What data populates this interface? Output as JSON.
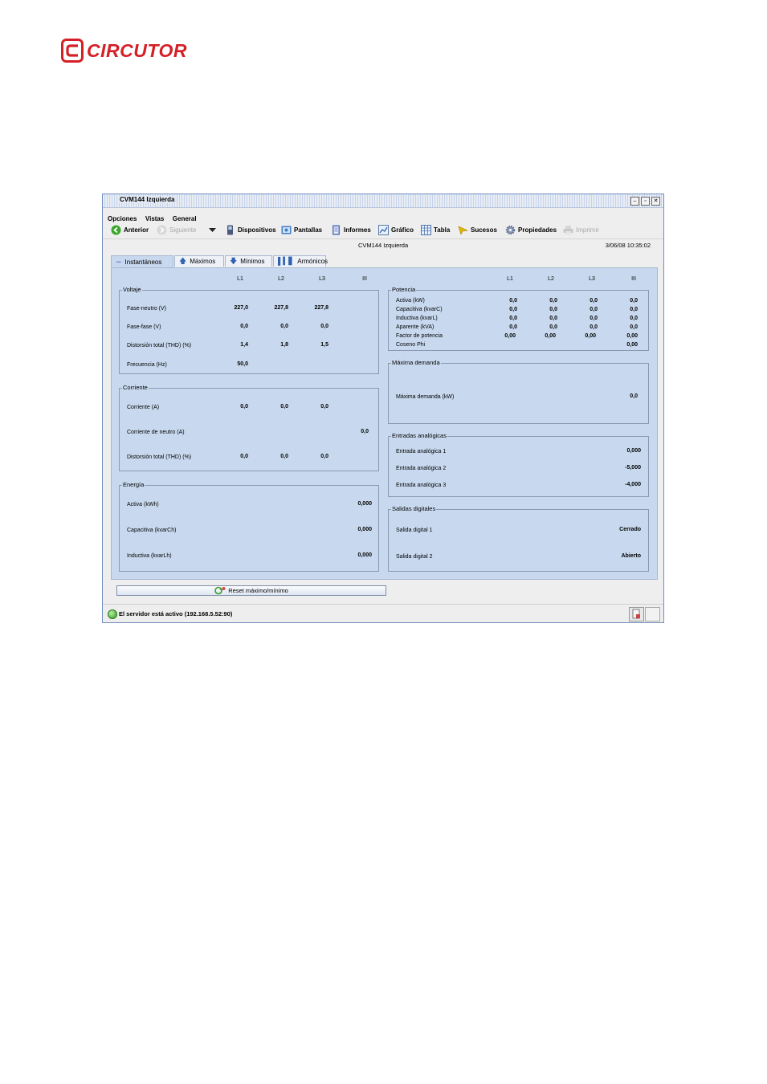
{
  "brand": {
    "logo_text": "CIRCUTOR",
    "color": "#d42027"
  },
  "window": {
    "title": "CVM144 Izquierda",
    "menu": [
      "Opciones",
      "Vistas",
      "General"
    ],
    "toolbar": {
      "anterior": "Anterior",
      "siguiente": "Siguiente",
      "dispositivos": "Dispositivos",
      "pantallas": "Pantallas",
      "informes": "Informes",
      "grafico": "Gráfico",
      "tabla": "Tabla",
      "sucesos": "Sucesos",
      "propiedades": "Propiedades",
      "imprimir": "Imprimir"
    },
    "device_name": "CVM144 Izquierda",
    "datetime": "3/06/08 10:35:02",
    "tabs": [
      "Instantáneos",
      "Máximos",
      "Mínimos",
      "Armónicos"
    ],
    "active_tab": "Instantáneos",
    "columns_left": [
      "L1",
      "L2",
      "L3",
      "III"
    ],
    "columns_right": [
      "L1",
      "L2",
      "L3",
      "III"
    ],
    "voltaje": {
      "title": "Voltaje",
      "rows": [
        {
          "label": "Fase-neutro (V)",
          "l1": "227,0",
          "l2": "227,8",
          "l3": "227,8"
        },
        {
          "label": "Fase-fase (V)",
          "l1": "0,0",
          "l2": "0,0",
          "l3": "0,0"
        },
        {
          "label": "Distorsión total (THD) (%)",
          "l1": "1,4",
          "l2": "1,8",
          "l3": "1,5"
        },
        {
          "label": "Frecuencia (Hz)",
          "l1": "50,0"
        }
      ]
    },
    "corriente": {
      "title": "Corriente",
      "rows": [
        {
          "label": "Corriente (A)",
          "l1": "0,0",
          "l2": "0,0",
          "l3": "0,0"
        },
        {
          "label": "Corriente de neutro (A)",
          "iii": "0,0"
        },
        {
          "label": "Distorsión total (THD) (%)",
          "l1": "0,0",
          "l2": "0,0",
          "l3": "0,0"
        }
      ]
    },
    "energia": {
      "title": "Energía",
      "rows": [
        {
          "label": "Activa (kWh)",
          "iii": "0,000"
        },
        {
          "label": "Capacitiva (kvarCh)",
          "iii": "0,000"
        },
        {
          "label": "Inductiva (kvarLh)",
          "iii": "0,000"
        }
      ]
    },
    "potencia": {
      "title": "Potencia",
      "rows": [
        {
          "label": "Activa (kW)",
          "l1": "0,0",
          "l2": "0,0",
          "l3": "0,0",
          "iii": "0,0"
        },
        {
          "label": "Capacitiva (kvarC)",
          "l1": "0,0",
          "l2": "0,0",
          "l3": "0,0",
          "iii": "0,0"
        },
        {
          "label": "Inductiva (kvarL)",
          "l1": "0,0",
          "l2": "0,0",
          "l3": "0,0",
          "iii": "0,0"
        },
        {
          "label": "Aparente (kVA)",
          "l1": "0,0",
          "l2": "0,0",
          "l3": "0,0",
          "iii": "0,0"
        },
        {
          "label": "Factor de potencia",
          "l1": "0,00",
          "l2": "0,00",
          "l3": "0,00",
          "iii": "0,00"
        },
        {
          "label": "Coseno Phi",
          "iii": "0,00"
        }
      ]
    },
    "maxima_demanda": {
      "title": "Máxima demanda",
      "rows": [
        {
          "label": "Máxima demanda (kW)",
          "iii": "0,0"
        }
      ]
    },
    "entradas": {
      "title": "Entradas analógicas",
      "rows": [
        {
          "label": "Entrada analógica 1",
          "value": "0,000"
        },
        {
          "label": "Entrada analógica 2",
          "value": "-5,000"
        },
        {
          "label": "Entrada analógica 3",
          "value": "-4,000"
        }
      ]
    },
    "salidas": {
      "title": "Salidas digitales",
      "rows": [
        {
          "label": "Salida digital 1",
          "value": "Cerrado"
        },
        {
          "label": "Salida digital 2",
          "value": "Abierto"
        }
      ]
    },
    "reset_button": "Reset máximo/mínimo",
    "status_text": "El servidor está activo (192.168.5.52:90)"
  }
}
